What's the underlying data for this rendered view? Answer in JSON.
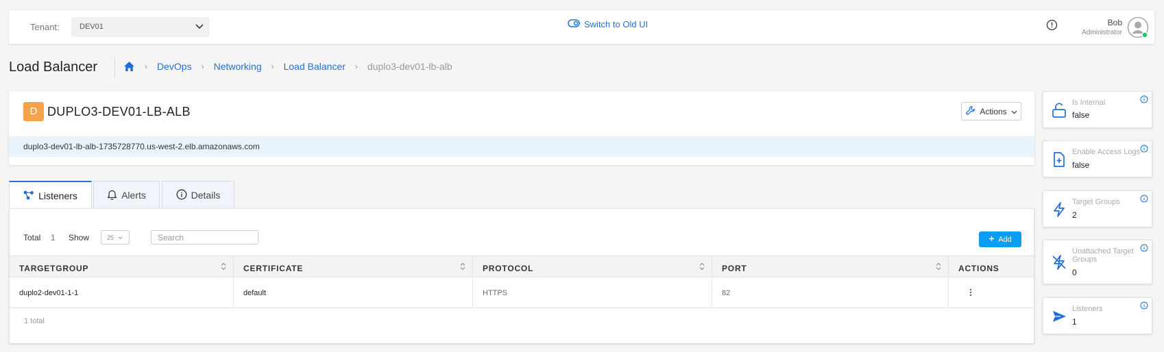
{
  "topbar": {
    "tenant_label": "Tenant:",
    "tenant_value": "DEV01",
    "switch_ui": "Switch to Old UI",
    "user_name": "Bob",
    "user_role": "Administrator"
  },
  "page": {
    "title": "Load Balancer",
    "breadcrumb": [
      "DevOps",
      "Networking",
      "Load Balancer",
      "duplo3-dev01-lb-alb"
    ]
  },
  "lb": {
    "avatar_letter": "D",
    "name": "DUPLO3-DEV01-LB-ALB",
    "actions_label": "Actions",
    "dns": "duplo3-dev01-lb-alb-1735728770.us-west-2.elb.amazonaws.com"
  },
  "tabs": [
    {
      "label": "Listeners",
      "icon": "share-nodes-icon",
      "active": true
    },
    {
      "label": "Alerts",
      "icon": "bell-icon",
      "active": false
    },
    {
      "label": "Details",
      "icon": "info-circle-icon",
      "active": false
    }
  ],
  "table": {
    "total_label": "Total",
    "total_value": "1",
    "show_label": "Show",
    "page_size": "25",
    "search_placeholder": "Search",
    "add_label": "Add",
    "columns": [
      "TARGETGROUP",
      "CERTIFICATE",
      "PROTOCOL",
      "PORT",
      "ACTIONS"
    ],
    "rows": [
      {
        "targetgroup": "duplo2-dev01-1-1",
        "certificate": "default",
        "protocol": "HTTPS",
        "port": "82"
      }
    ],
    "footer": "1 total"
  },
  "side_cards": [
    {
      "title": "Is Internal",
      "value": "false",
      "icon": "unlock-icon"
    },
    {
      "title": "Enable Access Logs",
      "value": "false",
      "icon": "file-plus-icon"
    },
    {
      "title": "Target Groups",
      "value": "2",
      "icon": "lightning-icon"
    },
    {
      "title": "Unattached Target Groups",
      "value": "0",
      "icon": "lightning-off-icon"
    },
    {
      "title": "Listeners",
      "value": "1",
      "icon": "send-icon"
    }
  ],
  "colors": {
    "accent": "#1e6fd9",
    "add_button": "#0a9ef0",
    "avatar": "#f4a24c",
    "dns_strip": "#e9f3fc",
    "online": "#22c55e"
  }
}
